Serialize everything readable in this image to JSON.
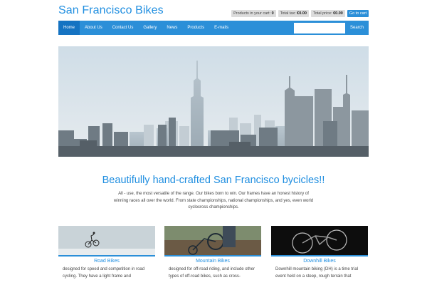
{
  "brand": "San Francisco Bikes",
  "cart": {
    "items_label": "Products in your cart:",
    "items_value": "0",
    "tax_label": "Total tax:",
    "tax_value": "€0.00",
    "price_label": "Total price:",
    "price_value": "€0.00",
    "go_label": "Go to cart"
  },
  "nav": {
    "items": [
      "Home",
      "About Us",
      "Contact Us",
      "Gallery",
      "News",
      "Products",
      "E-mails"
    ],
    "active": "Home",
    "search_placeholder": "",
    "search_button": "Search"
  },
  "main": {
    "headline": "Beautifully hand-crafted San Francisco bycicles!!",
    "intro": "All - use, the most versatile of the range. Our bikes born to win. Our frames have an honest history of winning races all over the world. From state championships, national championships, and yes, even world cyclocross championships."
  },
  "cards": [
    {
      "title": "Road Bikes",
      "desc": "designed for speed and competition in road cycling. They have a light frame and"
    },
    {
      "title": "Mountain Bikes",
      "desc": "designed for off-road riding, and include other types of off-road bikes, such as cross-"
    },
    {
      "title": "Downhill Bikes",
      "desc": "Downhill mountain biking (DH) is a time trial event held on a steep, rough terrain that"
    }
  ],
  "colors": {
    "accent": "#2b8fd8",
    "accent_dark": "#1573c2",
    "brand_text": "#1f8ee0"
  }
}
